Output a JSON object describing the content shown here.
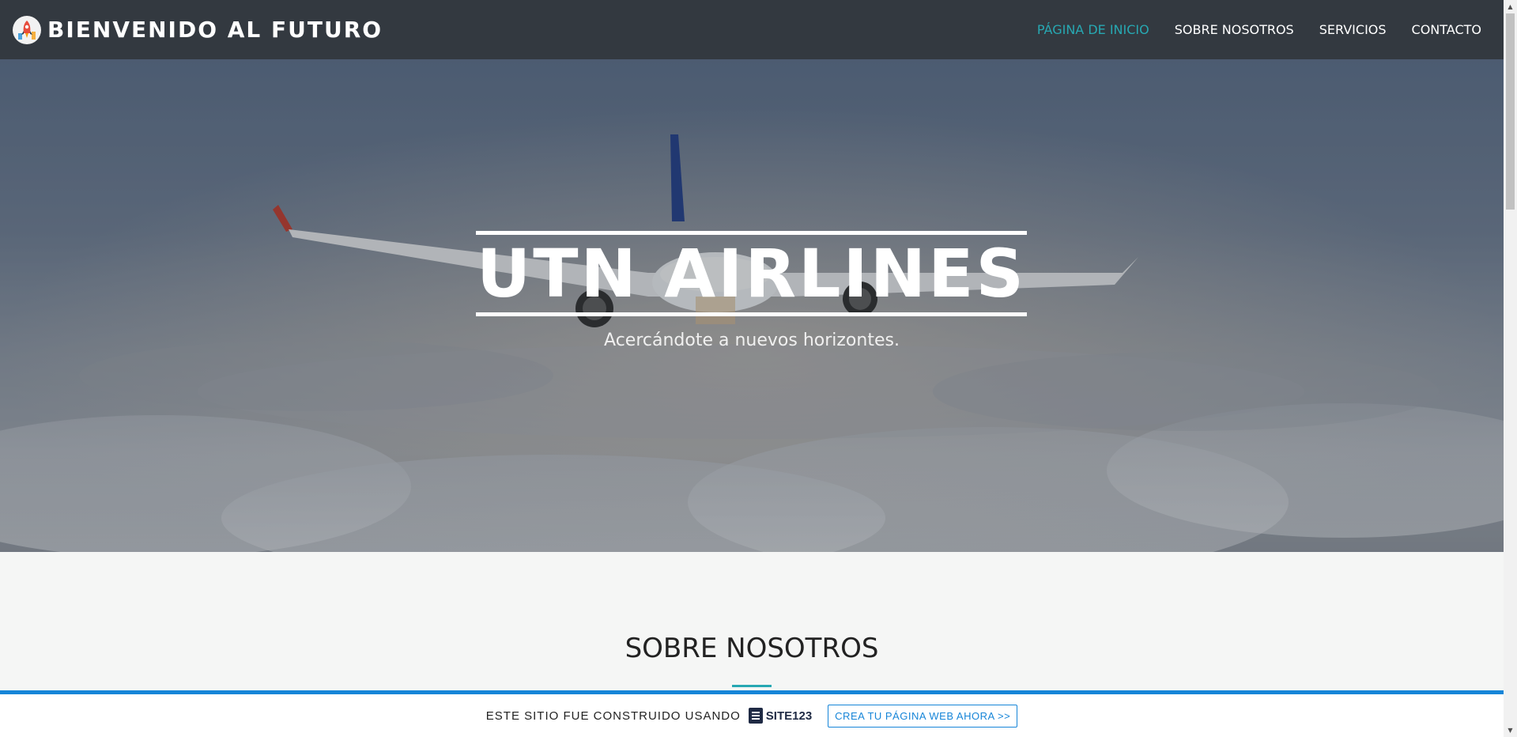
{
  "header": {
    "brand": "BIENVENIDO AL FUTURO",
    "nav": [
      {
        "label": "PÁGINA DE INICIO",
        "active": true
      },
      {
        "label": "SOBRE NOSOTROS",
        "active": false
      },
      {
        "label": "SERVICIOS",
        "active": false
      },
      {
        "label": "CONTACTO",
        "active": false
      }
    ]
  },
  "hero": {
    "title": "UTN AIRLINES",
    "subtitle": "Acercándote a nuevos horizontes."
  },
  "about": {
    "title": "SOBRE NOSOTROS"
  },
  "promo": {
    "text": "ESTE SITIO FUE CONSTRUIDO USANDO",
    "logo_text": "SITE123",
    "cta": "CREA TU PÁGINA WEB AHORA >>"
  },
  "colors": {
    "header_bg": "#333940",
    "accent": "#27a8b2",
    "promo_blue": "#1685d8"
  }
}
